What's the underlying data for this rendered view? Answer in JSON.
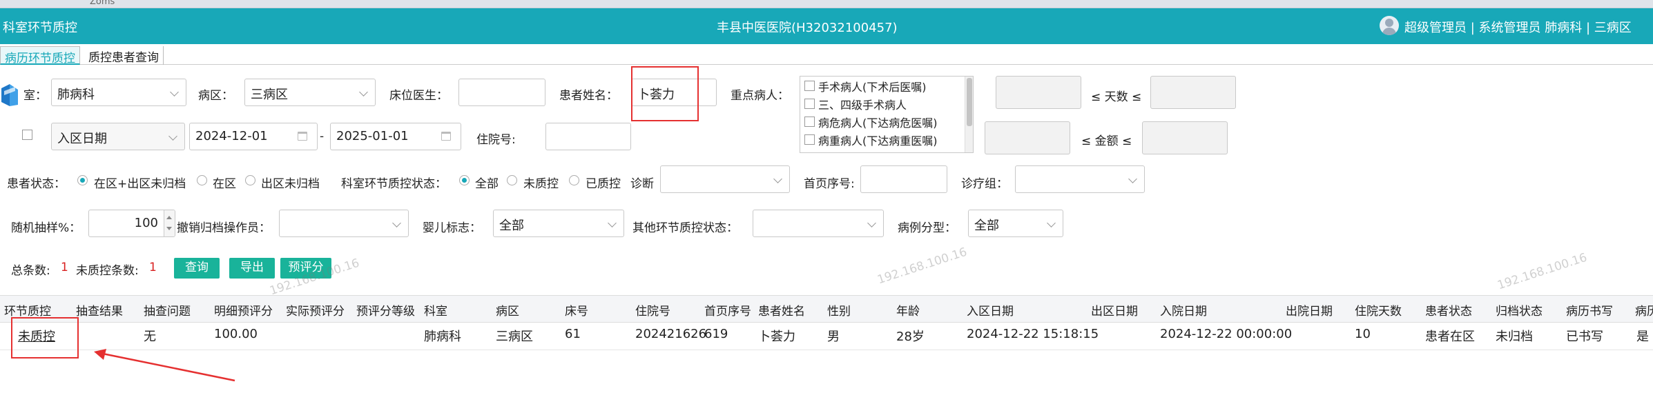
{
  "browser": {
    "tab_fragment": "Zoms"
  },
  "header": {
    "module_title": "科室环节质控",
    "hospital": "丰县中医医院(H32032100457)",
    "user": "超级管理员 | 系统管理员  肺病科 | 三病区"
  },
  "tabs": [
    {
      "label": "病历环节质控",
      "active": true
    },
    {
      "label": "质控患者查询",
      "active": false
    }
  ],
  "form": {
    "dept_label": "室：",
    "dept_value": "肺病科",
    "ward_label": "病区：",
    "ward_value": "三病区",
    "bed_doctor_label": "床位医生：",
    "bed_doctor_value": "",
    "patient_name_label": "患者姓名：",
    "patient_name_value": "卜荟力",
    "key_patient_label": "重点病人：",
    "key_patient_options": [
      "手术病人(下术后医嘱)",
      "三、四级手术病人",
      "病危病人(下达病危医嘱)",
      "病重病人(下达病重医嘱)"
    ],
    "days_label": "≤ 天数 ≤",
    "amount_label": "≤ 金额 ≤",
    "date_type_value": "入区日期",
    "date_from": "2024-12-01",
    "date_sep": "-",
    "date_to": "2025-01-01",
    "admission_no_label": "住院号:",
    "patient_status_label": "患者状态：",
    "patient_status_options": [
      "在区+出区未归档",
      "在区",
      "出区未归档"
    ],
    "qc_status_label": "科室环节质控状态：",
    "qc_status_options": [
      "全部",
      "未质控",
      "已质控"
    ],
    "diagnosis_label": "诊断",
    "first_page_no_label": "首页序号:",
    "treatment_group_label": "诊疗组：",
    "sampling_label": "随机抽样%：",
    "sampling_value": "100",
    "revoke_operator_label": "撤销归档操作员：",
    "infant_label": "婴儿标志：",
    "infant_value": "全部",
    "other_qc_label": "其他环节质控状态：",
    "case_type_label": "病例分型：",
    "case_type_value": "全部"
  },
  "summary": {
    "total_label": "总条数:",
    "total_value": "1",
    "unqc_label": "未质控条数:",
    "unqc_value": "1"
  },
  "buttons": {
    "query": "查询",
    "export": "导出",
    "pre_score": "预评分"
  },
  "watermark": "192.168.100.16",
  "table": {
    "headers": [
      "环节质控",
      "抽查结果",
      "抽查问题",
      "明细预评分",
      "实际预评分",
      "预评分等级",
      "科室",
      "病区",
      "床号",
      "住院号",
      "首页序号",
      "患者姓名",
      "性别",
      "年龄",
      "入区日期",
      "出区日期",
      "入院日期",
      "出院日期",
      "住院天数",
      "患者状态",
      "归档状态",
      "病历书写",
      "病历"
    ],
    "rows": [
      {
        "qc": "未质控",
        "check_result": "",
        "check_issue": "无",
        "detail_score": "100.00",
        "actual_score": "",
        "score_level": "",
        "dept": "肺病科",
        "ward": "三病区",
        "bed": "61",
        "admission_no": "202421626",
        "first_page_no": "619",
        "name": "卜荟力",
        "sex": "男",
        "age": "28岁",
        "ward_in_date": "2024-12-22 15:18:15",
        "ward_out_date": "",
        "admit_date": "2024-12-22 00:00:00",
        "discharge_date": "",
        "stay_days": "10",
        "patient_status": "患者在区",
        "archive_status": "未归档",
        "record_writing": "已书写",
        "last": "是"
      }
    ]
  },
  "colors": {
    "header_bg": "#18a8b8",
    "button_bg": "#19b39a",
    "annotation": "#e53030",
    "count_red": "#d82020"
  }
}
